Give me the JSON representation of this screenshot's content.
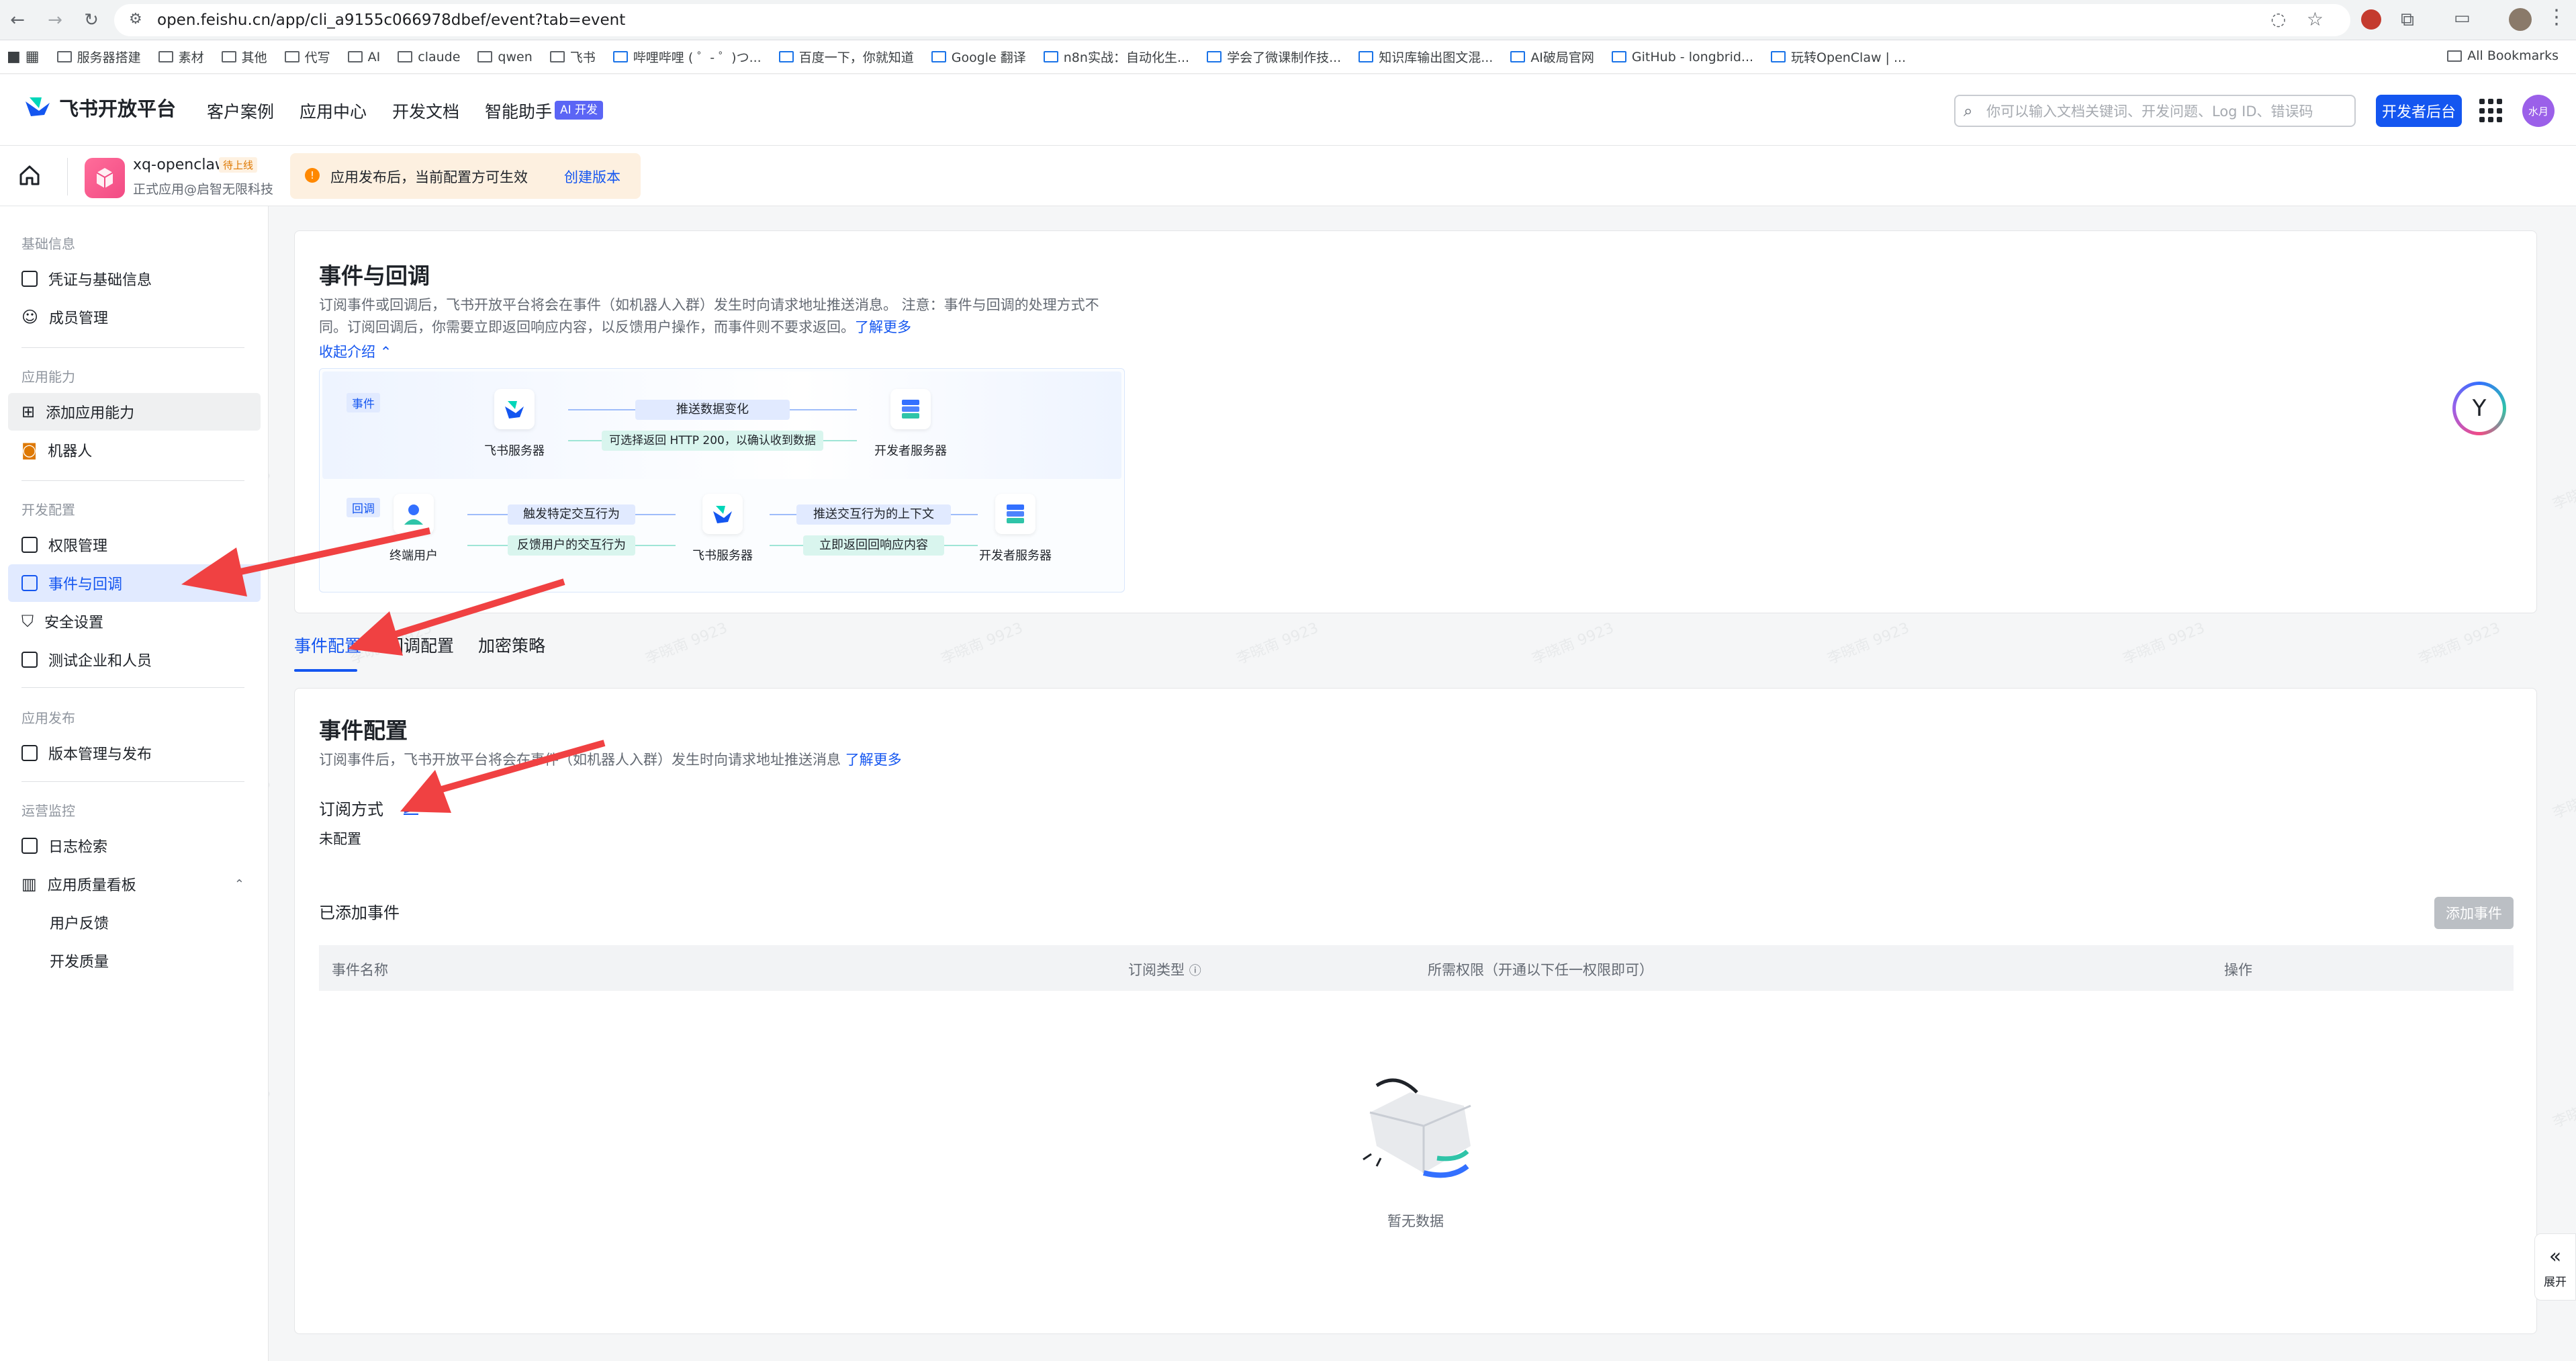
{
  "browser": {
    "url": "open.feishu.cn/app/cli_a9155c066978dbef/event?tab=event",
    "bookmarks": [
      "服务器搭建",
      "素材",
      "其他",
      "代写",
      "AI",
      "claude",
      "qwen",
      "飞书",
      "哔哩哔哩 ( ゜- ゜)つ...",
      "百度一下，你就知道",
      "Google 翻译",
      "n8n实战：自动化生...",
      "学会了微课制作技...",
      "知识库输出图文混...",
      "AI破局官网",
      "GitHub - longbrid...",
      "玩转OpenClaw | ..."
    ],
    "all_bookmarks": "All Bookmarks"
  },
  "header": {
    "brand": "飞书开放平台",
    "nav": [
      "客户案例",
      "应用中心",
      "开发文档",
      "智能助手"
    ],
    "ai_badge": "AI 开发",
    "search_placeholder": "你可以输入文档关键词、开发问题、Log ID、错误码",
    "dev_console": "开发者后台",
    "avatar": "水月"
  },
  "appbar": {
    "app_name": "xq-openclaw",
    "status_badge": "待上线",
    "app_sub": "正式应用@启智无限科技",
    "notice": "应用发布后，当前配置方可生效",
    "notice_link": "创建版本"
  },
  "sidebar": {
    "sections": [
      {
        "title": "基础信息",
        "items": [
          "凭证与基础信息",
          "成员管理"
        ]
      },
      {
        "title": "应用能力",
        "items": [
          "添加应用能力",
          "机器人"
        ]
      },
      {
        "title": "开发配置",
        "items": [
          "权限管理",
          "事件与回调",
          "安全设置",
          "测试企业和人员"
        ]
      },
      {
        "title": "应用发布",
        "items": [
          "版本管理与发布"
        ]
      },
      {
        "title": "运营监控",
        "items": [
          "日志检索",
          "应用质量看板",
          "用户反馈",
          "开发质量"
        ]
      }
    ]
  },
  "intro": {
    "title": "事件与回调",
    "desc_line1": "订阅事件或回调后，飞书开放平台将会在事件（如机器人入群）发生时向请求地址推送消息。 注意：事件与回调的处理方式不",
    "desc_line2": "同。订阅回调后，你需要立即返回响应内容，以反馈用户操作，而事件则不要求返回。",
    "learn_more": "了解更多",
    "collapse": "收起介绍",
    "event_tag": "事件",
    "callback_tag": "回调",
    "feishu_server": "飞书服务器",
    "dev_server": "开发者服务器",
    "end_user": "终端用户",
    "push_data": "推送数据变化",
    "optional_return": "可选择返回 HTTP 200，以确认收到数据",
    "trigger": "触发特定交互行为",
    "feedback": "反馈用户的交互行为",
    "push_context": "推送交互行为的上下文",
    "return_now": "立即返回回响应内容"
  },
  "tabs": [
    "事件配置",
    "回调配置",
    "加密策略"
  ],
  "event_config": {
    "title": "事件配置",
    "desc": "订阅事件后，飞书开放平台将会在事件（如机器人入群）发生时向请求地址推送消息",
    "learn_more": "了解更多",
    "sub_method_label": "订阅方式",
    "sub_method_value": "未配置",
    "added_events": "已添加事件",
    "add_event_btn": "添加事件",
    "columns": [
      "事件名称",
      "订阅类型",
      "所需权限（开通以下任一权限即可）",
      "操作"
    ],
    "empty": "暂无数据"
  },
  "expand": "展开",
  "watermark": "李晓南 9923",
  "colors": {
    "primary": "#1456f0",
    "annotation_arrow": "#f04142"
  }
}
